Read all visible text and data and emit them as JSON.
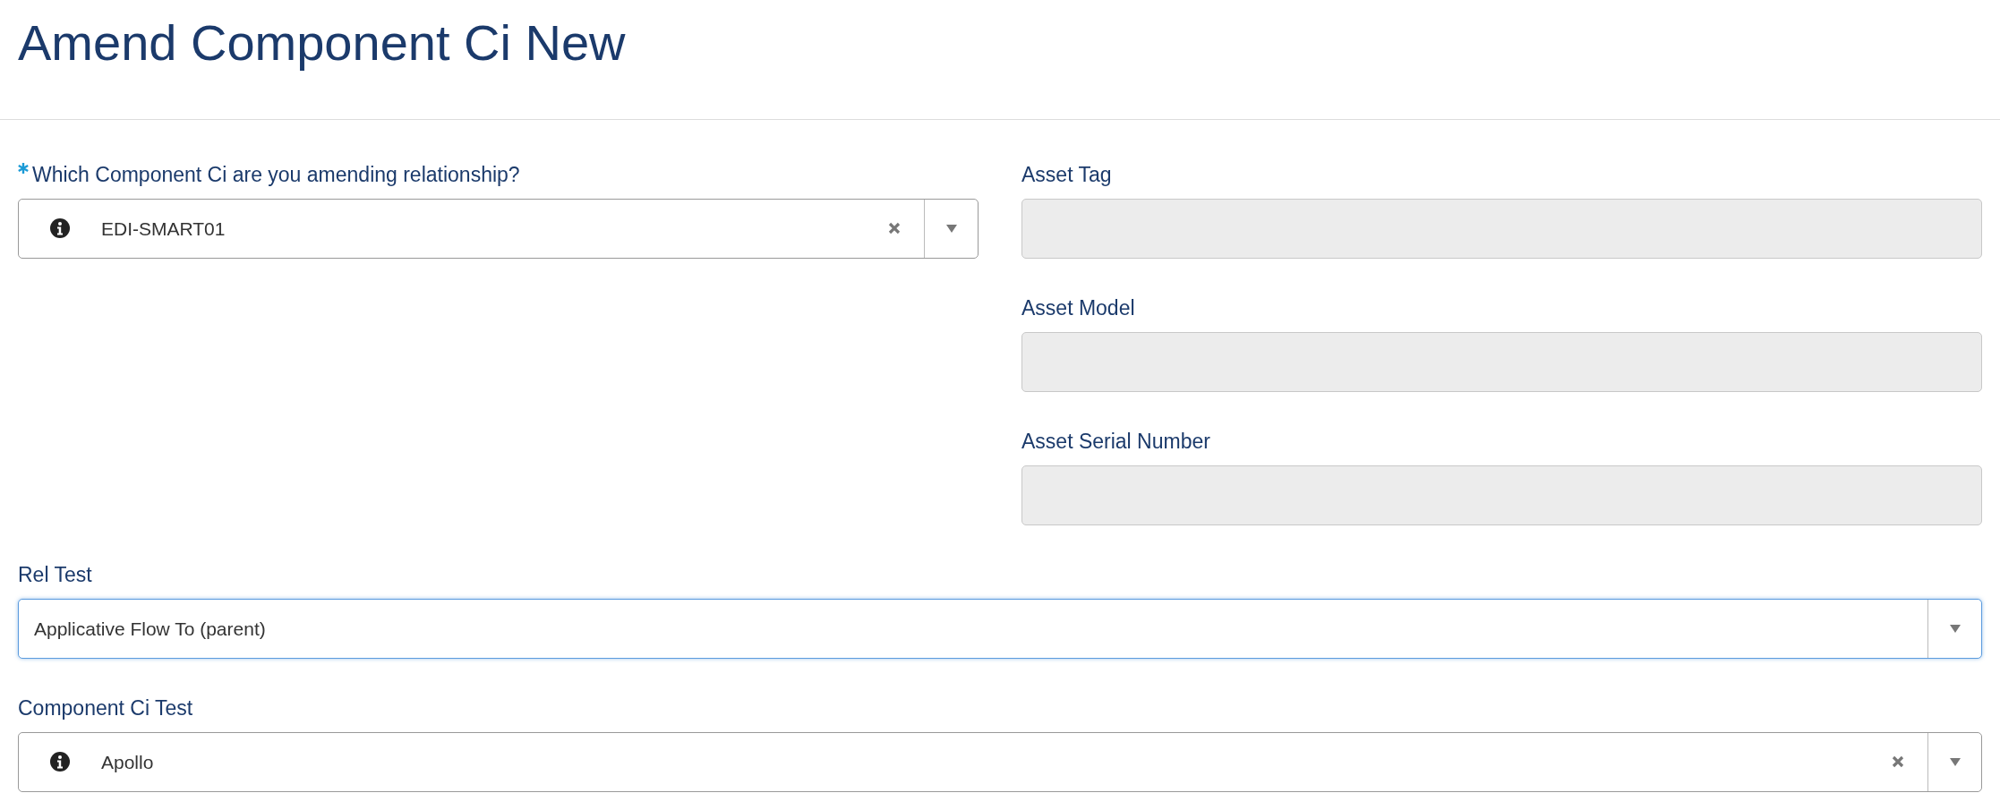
{
  "page_title": "Amend Component Ci New",
  "left_fields": [
    {
      "label": "Which Component Ci are you amending relationship?",
      "required": true,
      "kind": "lookup",
      "value": "EDI-SMART01",
      "focused": false
    }
  ],
  "right_fields": [
    {
      "label": "Asset Tag",
      "required": false,
      "kind": "readonly",
      "focused": false
    },
    {
      "label": "Asset Model",
      "required": false,
      "kind": "readonly",
      "focused": false
    },
    {
      "label": "Asset Serial Number",
      "required": false,
      "kind": "readonly",
      "focused": false
    }
  ],
  "full_fields": [
    {
      "label": "Rel Test",
      "required": false,
      "kind": "select",
      "value": "Applicative Flow To (parent)",
      "focused": true
    },
    {
      "label": "Component Ci Test",
      "required": false,
      "kind": "lookup",
      "value": "Apollo",
      "focused": false
    }
  ]
}
